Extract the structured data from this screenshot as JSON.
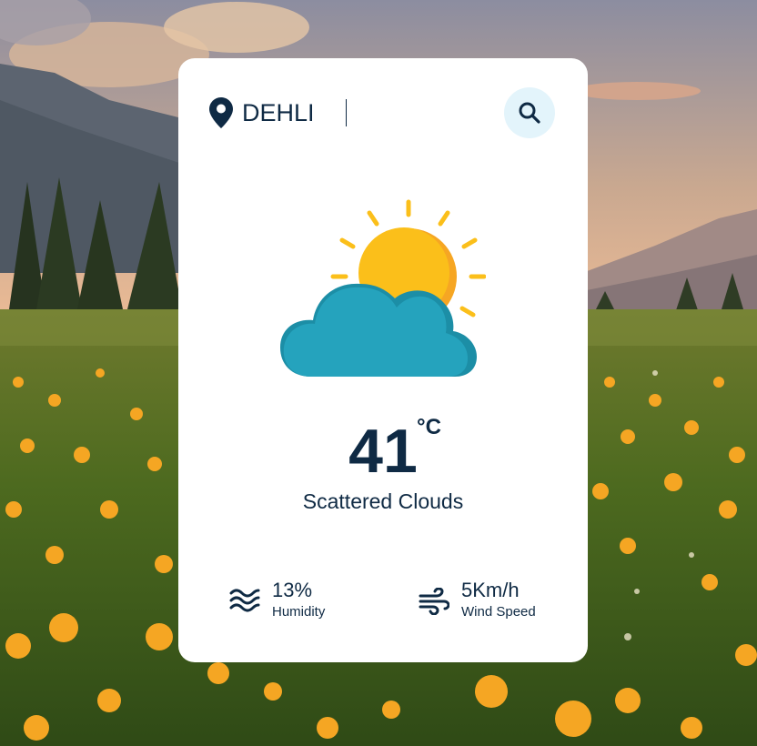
{
  "search": {
    "city_value": "DEHLI",
    "search_icon": "magnifier-icon",
    "location_icon": "map-pin-icon"
  },
  "weather": {
    "icon": "partly-cloudy-sun-icon",
    "temperature": "41",
    "unit": "°C",
    "condition": "Scattered Clouds"
  },
  "details": {
    "humidity": {
      "icon": "water-waves-icon",
      "value": "13%",
      "label": "Humidity"
    },
    "wind": {
      "icon": "wind-icon",
      "value": "5Km/h",
      "label": "Wind Speed"
    }
  },
  "colors": {
    "text": "#0f2a44",
    "card": "#ffffff",
    "search_button_bg": "#e3f4fb",
    "sun": "#fbbf1a",
    "sun_shade": "#f6a623",
    "cloud": "#25a3bd",
    "cloud_shade": "#1c8ea6"
  }
}
